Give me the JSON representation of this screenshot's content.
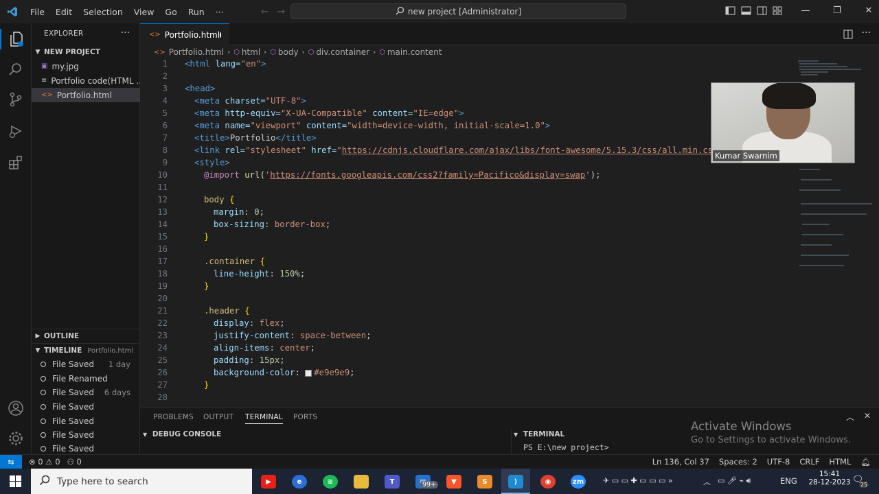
{
  "window": {
    "menu": [
      "File",
      "Edit",
      "Selection",
      "View",
      "Go",
      "Run",
      "···"
    ],
    "command_center": "new project [Administrator]"
  },
  "sidebar": {
    "title": "EXPLORER",
    "project_name": "NEW PROJECT",
    "files": [
      {
        "name": "my.jpg",
        "icon": "image-icon"
      },
      {
        "name": "Portfolio code(HTML ...",
        "icon": "file-icon"
      },
      {
        "name": "Portfolio.html",
        "icon": "html-file-icon"
      }
    ],
    "outline_title": "OUTLINE",
    "timeline_title": "TIMELINE",
    "timeline_file": "Portfolio.html",
    "timeline": [
      {
        "label": "File Saved",
        "time": "1 day"
      },
      {
        "label": "File Renamed",
        "time": ""
      },
      {
        "label": "File Saved",
        "time": "6 days"
      },
      {
        "label": "File Saved",
        "time": ""
      },
      {
        "label": "File Saved",
        "time": ""
      },
      {
        "label": "File Saved",
        "time": ""
      },
      {
        "label": "File Saved",
        "time": ""
      }
    ]
  },
  "editor": {
    "tab_label": "Portfolio.html",
    "breadcrumb": [
      "Portfolio.html",
      "html",
      "body",
      "div.container",
      "main.content"
    ],
    "line_numbers": [
      "1",
      "2",
      "3",
      "4",
      "5",
      "6",
      "7",
      "8",
      "9",
      "10",
      "11",
      "12",
      "13",
      "14",
      "15",
      "16",
      "17",
      "18",
      "19",
      "20",
      "21",
      "22",
      "23",
      "24",
      "25",
      "26",
      "27",
      "28"
    ],
    "code": {
      "l1": [
        "<html",
        " lang=",
        "\"en\"",
        ">"
      ],
      "l3": "<head>",
      "l4": [
        "<meta",
        " charset=",
        "\"UTF-8\"",
        ">"
      ],
      "l5": [
        "<meta",
        " http-equiv=",
        "\"X-UA-Compatible\"",
        " content=",
        "\"IE=edge\"",
        ">"
      ],
      "l6": [
        "<meta",
        " name=",
        "\"viewport\"",
        " content=",
        "\"width=device-width, initial-scale=1.0\"",
        ">"
      ],
      "l7": [
        "<title>",
        "Portfolio",
        "</title>"
      ],
      "l8": [
        "<link",
        " rel=",
        "\"stylesheet\"",
        " href=",
        "\"",
        "https://cdnjs.cloudflare.com/ajax/libs/font-awesome/5.15.3/css/all.min.css",
        "\""
      ],
      "l9": "<style>",
      "l10": [
        "@import",
        " url(",
        "'",
        "https://fonts.googleapis.com/css2?family=Pacifico&display=swap",
        "'",
        ");"
      ],
      "l12": [
        "body",
        " {"
      ],
      "l13": [
        "margin",
        ": ",
        "0",
        ";"
      ],
      "l14": [
        "box-sizing",
        ": ",
        "border-box",
        ";"
      ],
      "l15": "}",
      "l17": [
        ".container",
        " {"
      ],
      "l18": [
        "line-height",
        ": ",
        "150%",
        ";"
      ],
      "l19": "}",
      "l21": [
        ".header",
        " {"
      ],
      "l22": [
        "display",
        ": ",
        "flex",
        ";"
      ],
      "l23": [
        "justify-content",
        ": ",
        "space-between",
        ";"
      ],
      "l24": [
        "align-items",
        ": ",
        "center",
        ";"
      ],
      "l25": [
        "padding",
        ": ",
        "15px",
        ";"
      ],
      "l26": [
        "background-color",
        ": ",
        "#e9e9e9",
        ";"
      ],
      "l27": "}"
    }
  },
  "webcam": {
    "name": "Kumar Swarnim"
  },
  "panel": {
    "tabs": [
      "PROBLEMS",
      "OUTPUT",
      "TERMINAL",
      "PORTS"
    ],
    "debug_console": "DEBUG CONSOLE",
    "terminal_title": "TERMINAL",
    "terminal_prompt": "PS E:\\new project>"
  },
  "watermark": {
    "line1": "Activate Windows",
    "line2": "Go to Settings to activate Windows."
  },
  "statusbar": {
    "errors": "0",
    "warnings": "0",
    "ports": "0",
    "position": "Ln 136, Col 37",
    "spaces": "Spaces: 2",
    "encoding": "UTF-8",
    "eol": "CRLF",
    "language": "HTML"
  },
  "taskbar": {
    "search_placeholder": "Type here to search",
    "mail_badge": "99+",
    "zoom_label": "zm",
    "teams_label": "T",
    "language": "ENG",
    "time": "15:41",
    "date": "28-12-2023",
    "notifications": "25"
  },
  "colors": {
    "accent": "#0078d4",
    "background": "#1f1f1f",
    "swatch": "#e9e9e9"
  }
}
